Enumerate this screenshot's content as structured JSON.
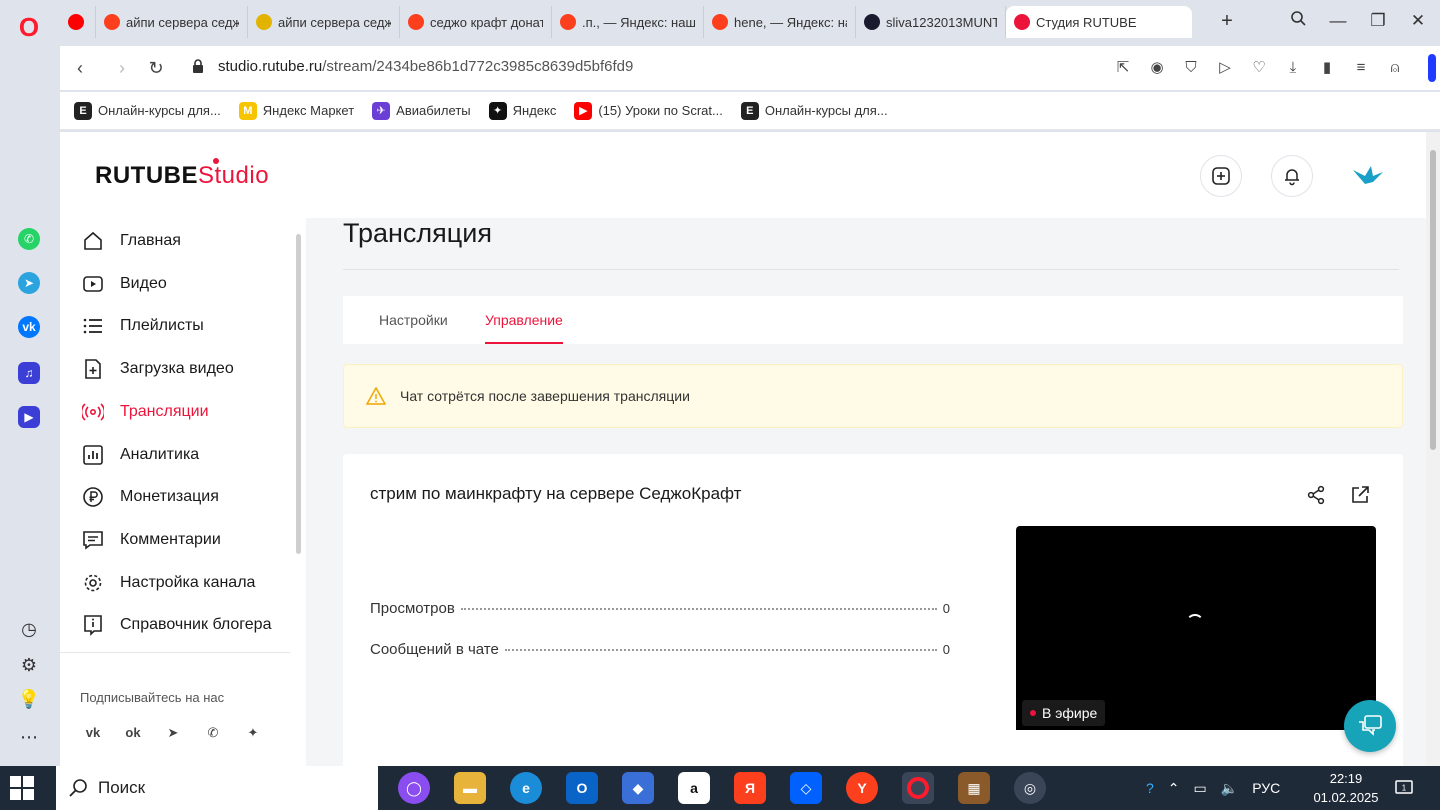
{
  "browser": {
    "tabs": [
      {
        "title": "",
        "favicon": "youtube-icon",
        "color": "#ff0000",
        "width": 36
      },
      {
        "title": "айпи сервера седж",
        "favicon": "yandex-icon",
        "color": "#fc3f1d",
        "width": 152
      },
      {
        "title": "айпи сервера седж",
        "favicon": "image-icon",
        "color": "#e2b300",
        "width": 152
      },
      {
        "title": "седжо крафт донат",
        "favicon": "yandex-icon",
        "color": "#fc3f1d",
        "width": 152
      },
      {
        "title": ".п., — Яндекс: нашл",
        "favicon": "yandex-icon",
        "color": "#fc3f1d",
        "width": 152
      },
      {
        "title": "hene, — Яндекс: на",
        "favicon": "yandex-icon",
        "color": "#fc3f1d",
        "width": 152
      },
      {
        "title": "sliva1232013MUNT",
        "favicon": "rutube-r-icon",
        "color": "#1a1a2e",
        "width": 150
      },
      {
        "title": "Студия RUTUBE",
        "favicon": "rutube-studio-icon",
        "color": "#ed143b",
        "width": 186,
        "active": true
      }
    ],
    "url_host": "studio.rutube.ru",
    "url_path": "/stream/2434be86b1d772c3985c8639d5bf6fd9",
    "bookmarks": [
      {
        "label": "Онлайн-курсы для...",
        "icon": "E",
        "color": "#222"
      },
      {
        "label": "Яндекс Маркет",
        "icon": "M",
        "color": "#f6c500"
      },
      {
        "label": "Авиабилеты",
        "icon": "✈",
        "color": "#6b3fd6"
      },
      {
        "label": "Яндекс",
        "icon": "✦",
        "color": "#111"
      },
      {
        "label": "(15) Уроки по Scrat...",
        "icon": "▶",
        "color": "#ff0000"
      },
      {
        "label": "Онлайн-курсы для...",
        "icon": "E",
        "color": "#222"
      }
    ]
  },
  "studio": {
    "logo_main": "RUTUBE",
    "logo_sub": "Studio",
    "nav": [
      {
        "label": "Главная",
        "icon": "home-icon"
      },
      {
        "label": "Видео",
        "icon": "video-icon"
      },
      {
        "label": "Плейлисты",
        "icon": "playlists-icon"
      },
      {
        "label": "Загрузка видео",
        "icon": "upload-icon"
      },
      {
        "label": "Трансляции",
        "icon": "broadcast-icon",
        "active": true
      },
      {
        "label": "Аналитика",
        "icon": "analytics-icon"
      },
      {
        "label": "Монетизация",
        "icon": "ruble-icon"
      },
      {
        "label": "Комментарии",
        "icon": "comments-icon"
      },
      {
        "label": "Настройка канала",
        "icon": "gear-icon"
      },
      {
        "label": "Справочник блогера",
        "icon": "info-book-icon"
      }
    ],
    "subscribe_label": "Подписывайтесь на нас",
    "socials": [
      "vk",
      "ok",
      "telegram",
      "viber",
      "zen"
    ],
    "page_title": "Трансляция",
    "tabs": [
      {
        "label": "Настройки",
        "active": false
      },
      {
        "label": "Управление",
        "active": true
      }
    ],
    "warning": "Чат сотрётся после завершения трансляции",
    "stream_title": "стрим по маинкрафту на сервере СеджоКрафт",
    "stats": [
      {
        "label": "Просмотров",
        "value": "0"
      },
      {
        "label": "Сообщений в чате",
        "value": "0"
      }
    ],
    "live_badge": "В эфире"
  },
  "taskbar": {
    "search_label": "Поиск",
    "lang": "РУС",
    "time": "22:19",
    "date": "01.02.2025",
    "notif_count": "1"
  },
  "colors": {
    "accent": "#ed143b",
    "warning_bg": "#fffbe6",
    "help": "#17a3b8"
  }
}
